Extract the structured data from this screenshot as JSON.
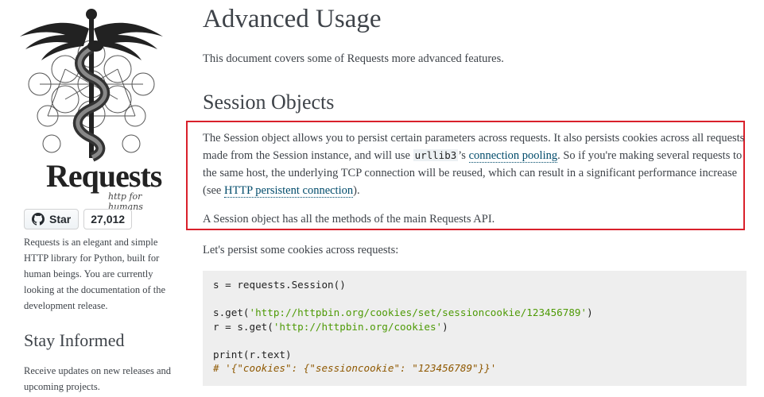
{
  "sidebar": {
    "logo": {
      "wordmark": "Requests",
      "tagline": "http for humans"
    },
    "github": {
      "star_label": "Star",
      "star_count": "27,012"
    },
    "description": "Requests is an elegant and simple HTTP library for Python, built for human beings. You are currently looking at the documentation of the development release.",
    "stay_informed_heading": "Stay Informed",
    "stay_informed_text": "Receive updates on new releases and upcoming projects."
  },
  "main": {
    "title": "Advanced Usage",
    "intro": "This document covers some of Requests more advanced features.",
    "section_title": "Session Objects",
    "para1": {
      "part1": "The Session object allows you to persist certain parameters across requests. It also persists cookies across all requests made from the Session instance, and will use ",
      "code": "urllib3",
      "part2": "’s ",
      "link1": "connection pooling",
      "part3": ". So if you're making several requests to the same host, the underlying TCP connection will be reused, which can result in a significant performance increase (see ",
      "link2": "HTTP persistent connection",
      "part4": ")."
    },
    "para2": "A Session object has all the methods of the main Requests API.",
    "para3": "Let's persist some cookies across requests:",
    "code": {
      "line1": "s = requests.Session()",
      "line3_pre": "s.get(",
      "line3_str": "'http://httpbin.org/cookies/set/sessioncookie/123456789'",
      "line3_post": ")",
      "line4_pre": "r = s.get(",
      "line4_str": "'http://httpbin.org/cookies'",
      "line4_post": ")",
      "line6": "print(r.text)",
      "line7": "# '{\"cookies\": {\"sessioncookie\": \"123456789\"}}'"
    },
    "highlight_color": "#d9202b",
    "link_color": "#004b6b"
  }
}
